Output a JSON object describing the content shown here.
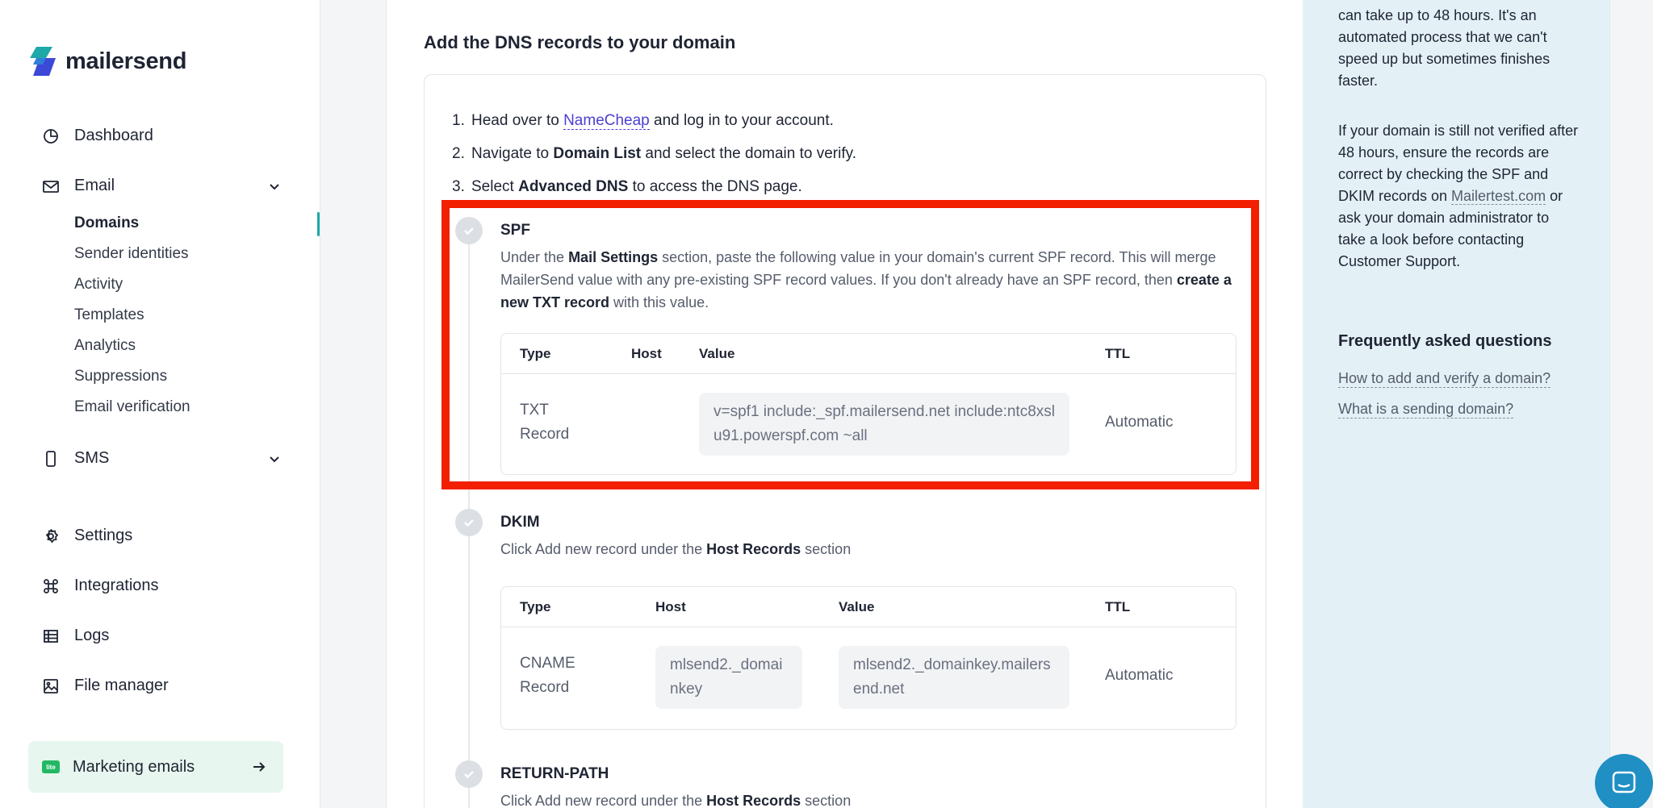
{
  "brand": {
    "name": "mailersend"
  },
  "nav": {
    "dashboard": "Dashboard",
    "email": "Email",
    "email_sub": [
      "Domains",
      "Sender identities",
      "Activity",
      "Templates",
      "Analytics",
      "Suppressions",
      "Email verification"
    ],
    "sms": "SMS",
    "settings": "Settings",
    "integrations": "Integrations",
    "logs": "Logs",
    "file_manager": "File manager",
    "marketing": "Marketing emails",
    "lite_badge": "lite"
  },
  "main": {
    "title": "Add the DNS records to your domain",
    "steps": {
      "s1_num": "1.",
      "s1_pre": "Head over to ",
      "s1_link": "NameCheap",
      "s1_post": " and log in to your account.",
      "s2_num": "2.",
      "s2_pre": "Navigate to ",
      "s2_bold": "Domain List",
      "s2_post": " and select the domain to verify.",
      "s3_num": "3.",
      "s3_pre": "Select ",
      "s3_bold": "Advanced DNS",
      "s3_post": " to access the DNS page."
    },
    "spf": {
      "title": "SPF",
      "d1": "Under the ",
      "d1b": "Mail Settings",
      "d2": " section, paste the following value in your domain's current SPF record. This will merge MailerSend value with any pre-existing SPF record values. If you don't already have an SPF record, then ",
      "d2b": "create a new TXT record",
      "d3": " with this value.",
      "headers": {
        "type": "Type",
        "host": "Host",
        "value": "Value",
        "ttl": "TTL"
      },
      "row": {
        "type": "TXT Record",
        "host": "",
        "value": "v=spf1 include:_spf.mailersend.net include:ntc8xslu91.powerspf.com ~all",
        "ttl": "Automatic"
      }
    },
    "dkim": {
      "title": "DKIM",
      "d1": "Click Add new record under the ",
      "d1b": "Host Records",
      "d2": " section",
      "headers": {
        "type": "Type",
        "host": "Host",
        "value": "Value",
        "ttl": "TTL"
      },
      "row": {
        "type": "CNAME Record",
        "host": "mlsend2._domainkey",
        "value": "mlsend2._domainkey.mailersend.net",
        "ttl": "Automatic"
      }
    },
    "return_path": {
      "title": "RETURN-PATH",
      "d1": "Click Add new record under the ",
      "d1b": "Host Records",
      "d2": " section"
    }
  },
  "right": {
    "p1": "can take up to 48 hours. It's an automated process that we can't speed up but sometimes finishes faster.",
    "p2_pre": "If your domain is still not verified after 48 hours, ensure the records are correct by checking the SPF and DKIM records on ",
    "p2_link": "Mailertest.com",
    "p2_post": " or ask your domain administrator to take a look before contacting Customer Support.",
    "faq_title": "Frequently asked questions",
    "faq": [
      "How to add and verify a domain?",
      "What is a sending domain?"
    ]
  },
  "colors": {
    "accent": "#1fa8a8",
    "highlight": "#f21f00",
    "link": "#4b3fd1",
    "panel": "#e3f1f7",
    "chat": "#1f8fc4"
  }
}
